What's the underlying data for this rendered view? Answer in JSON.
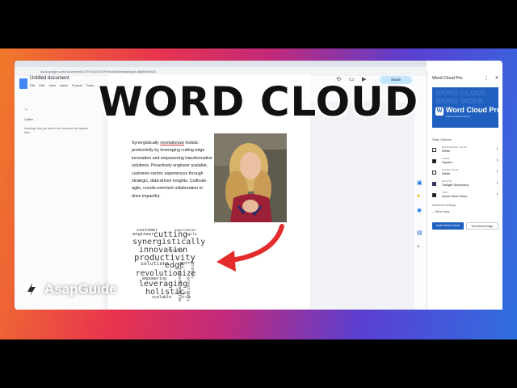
{
  "overlay": {
    "title": "WORD CLOUD",
    "brand": "AsapGuide"
  },
  "browser": {
    "address": "docs.google.com/document/d/1TR7hUSKXDRX9U/edit#heading=h.dfjkf5l7hWd2"
  },
  "docs": {
    "doc_title": "Untitled document",
    "menu": [
      "File",
      "Edit",
      "View",
      "Insert",
      "Format",
      "Tools",
      "Extensions",
      "Help"
    ],
    "share_label": "Share",
    "zoom": "100%",
    "style_select": "Normal",
    "font_select": "Arial",
    "outline": {
      "title": "Outline",
      "note": "Headings that you add to the document will appear here."
    }
  },
  "document": {
    "paragraph_parts": [
      "Synergistically ",
      "revolutionize",
      " holistic productivity by leveraging cutting-edge innovation and empowering transformative solutions. Proactively engineer scalable, customer-centric experiences through strategic, data-driven insights. Cultivate agile, results-oriented collaboration to drive impactful,"
    ]
  },
  "word_cloud": {
    "words": [
      "customer",
      "experiences",
      "engineer",
      "cutting",
      "agile",
      "synergistically",
      "innovation",
      "productivity",
      "solutions",
      "edge",
      "centric",
      "revolutionize",
      "empowering",
      "transformative",
      "leveraging",
      "holistic",
      "scalable",
      "drive",
      "proactively",
      "insights",
      "strategic",
      "results"
    ]
  },
  "panel": {
    "title": "Word Cloud Pro",
    "banner_name": "Word Cloud Pro",
    "banner_sub": "FOR GOOGLE DOCS",
    "banner_bg": "WORD CLOUD WORD WORK PRO",
    "style_options_label": "Style Options",
    "options": [
      {
        "label": "Background color",
        "value": "White",
        "swatch": "#ffffff"
      },
      {
        "label": "Shape",
        "value": "Square",
        "swatch": "#111111"
      },
      {
        "label": "Shape color",
        "value": "White",
        "swatch": "#ffffff"
      },
      {
        "label": "Palette",
        "value": "Twilight Symphony",
        "swatch": "#3b3f8c"
      },
      {
        "label": "Font",
        "value": "Dosis Semi Mono",
        "swatch": "#1a1a1a"
      }
    ],
    "advanced_label": "Advanced Settings",
    "show_more": "Show more",
    "insert_button": "Insert Word Cloud",
    "download_button": "Download image"
  },
  "colors": {
    "accent": "#1f5fbf",
    "arrow": "#e32b2b"
  }
}
